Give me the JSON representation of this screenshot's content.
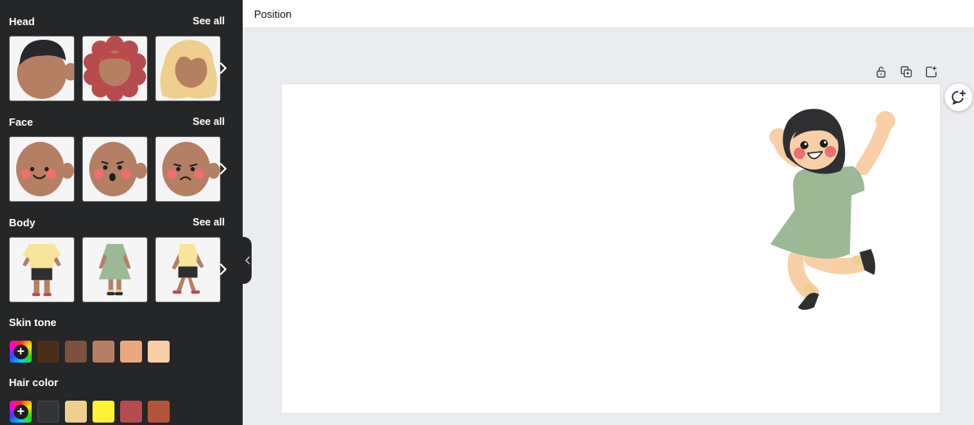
{
  "topbar": {
    "position_label": "Position"
  },
  "sections": {
    "head": {
      "title": "Head",
      "see_all": "See all"
    },
    "face": {
      "title": "Face",
      "see_all": "See all"
    },
    "body": {
      "title": "Body",
      "see_all": "See all"
    },
    "skin_tone": {
      "title": "Skin tone"
    },
    "hair_color": {
      "title": "Hair color"
    }
  },
  "colors": {
    "panel_bg": "#252627",
    "skin_tones": [
      "#4a2e1a",
      "#7d5240",
      "#b57f63",
      "#eaa87c",
      "#f9cfa6"
    ],
    "hair_colors": [
      "#323436",
      "#efcf8d",
      "#fff234",
      "#b84b4e",
      "#b5533a"
    ]
  },
  "icons": {
    "row_arrow": "chevron-right-icon",
    "add_color": "plus-icon",
    "collapse": "chevron-left-icon",
    "lock": "lock-icon",
    "duplicate": "duplicate-icon",
    "add_page": "add-page-icon",
    "comment": "add-comment-icon"
  }
}
